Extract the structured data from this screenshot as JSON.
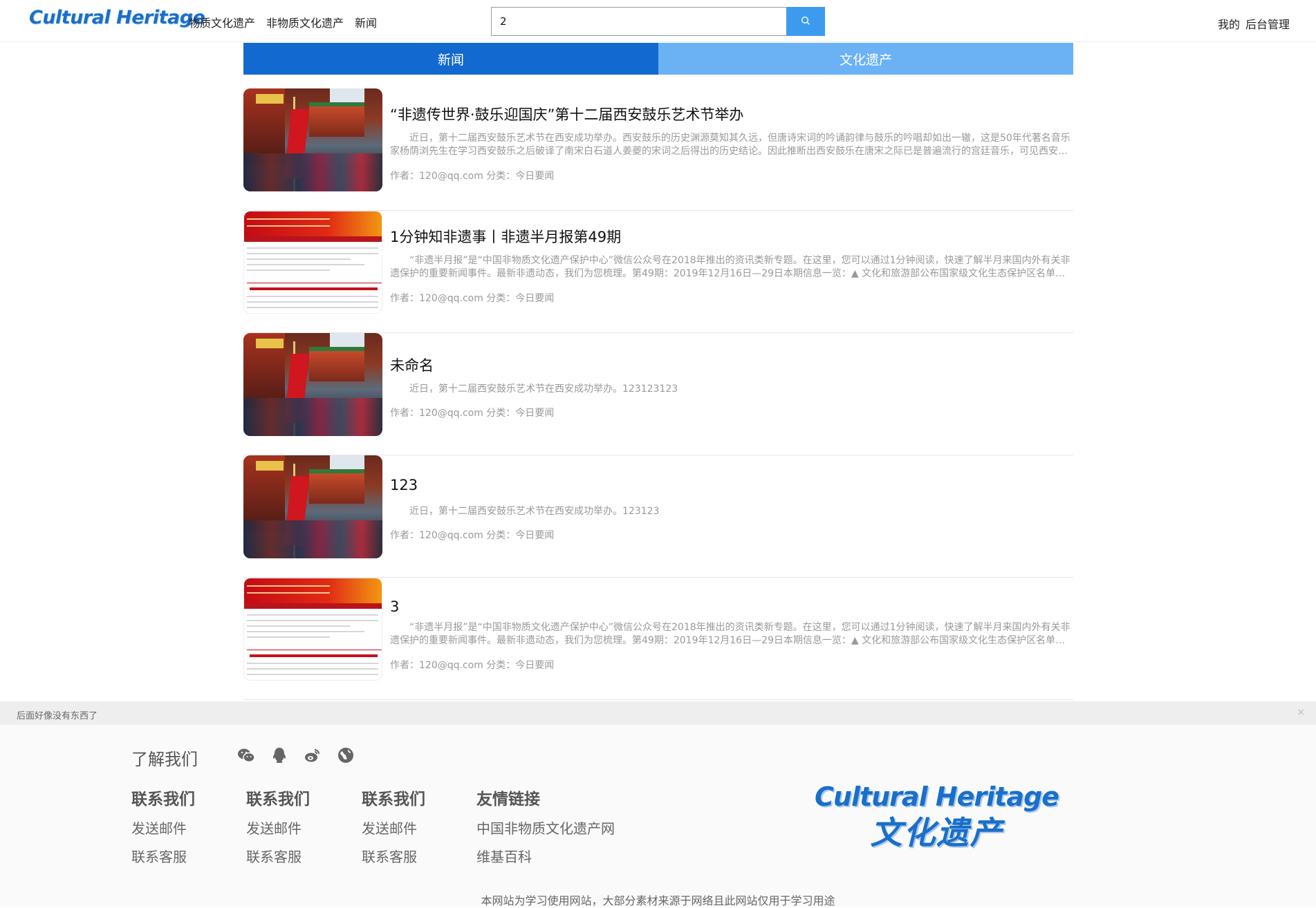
{
  "header": {
    "logo": "Cultural Heritage",
    "nav": [
      "物质文化遗产",
      "非物质文化遗产",
      "新闻"
    ],
    "search_value": "2",
    "user_links": [
      "我的",
      "后台管理"
    ]
  },
  "tabs": [
    {
      "label": "新闻",
      "active": true
    },
    {
      "label": "文化遗产",
      "active": false
    }
  ],
  "news": [
    {
      "title": "“非遗传世界·鼓乐迎国庆”第十二届西安鼓乐艺术节举办",
      "summary": "近日，第十二届西安鼓乐艺术节在西安成功举办。西安鼓乐的历史渊源莫知其久远，但唐诗宋词的吟诵韵律与鼓乐的吟唱却如出一辙，这是50年代著名音乐家杨荫浏先生在学习西安鼓乐之后破译了南宋白石道人姜夔的宋词之后得出的历史结论。因此推断出西安鼓乐在唐宋之际已是普遍流行的宫廷音乐，可见西安鼓乐历史之悠久。",
      "meta": "作者：120@qq.com 分类：今日要闻",
      "thumb": "street"
    },
    {
      "title": "1分钟知非遗事丨非遗半月报第49期",
      "summary": "“非遗半月报”是“中国非物质文化遗产保护中心”微信公众号在2018年推出的资讯类新专题。在这里，您可以通过1分钟阅读，快速了解半月来国内外有关非遗保护的重要新闻事件。最新非遗动态，我们为您梳理。第49期：2019年12月16日—29日本期信息一览：▲ 文化和旅游部公布国家级文化生态保护区名单▲ 第二届非遗影像展",
      "meta": "作者：120@qq.com 分类：今日要闻",
      "thumb": "doc"
    },
    {
      "title": "未命名",
      "summary": "近日，第十二届西安鼓乐艺术节在西安成功举办。123123123",
      "meta": "作者：120@qq.com 分类：今日要闻",
      "thumb": "street"
    },
    {
      "title": "123",
      "summary": "近日，第十二届西安鼓乐艺术节在西安成功举办。123123",
      "meta": "作者：120@qq.com 分类：今日要闻",
      "thumb": "street"
    },
    {
      "title": "3",
      "summary": "“非遗半月报”是“中国非物质文化遗产保护中心”微信公众号在2018年推出的资讯类新专题。在这里，您可以通过1分钟阅读，快速了解半月来国内外有关非遗保护的重要新闻事件。最新非遗动态，我们为您梳理。第49期：2019年12月16日—29日本期信息一览：▲ 文化和旅游部公布国家级文化生态保护区名单▲ 第二届非遗影像展",
      "meta": "作者：120@qq.com 分类：今日要闻",
      "thumb": "doc"
    }
  ],
  "notice": {
    "text": "后面好像没有东西了",
    "close": "×"
  },
  "footer": {
    "about": "了解我们",
    "social_icons": [
      "wechat-icon",
      "qq-icon",
      "weibo-icon",
      "globe-icon"
    ],
    "columns": [
      {
        "head": "联系我们",
        "links": [
          "发送邮件",
          "联系客服"
        ]
      },
      {
        "head": "联系我们",
        "links": [
          "发送邮件",
          "联系客服"
        ]
      },
      {
        "head": "联系我们",
        "links": [
          "发送邮件",
          "联系客服"
        ]
      },
      {
        "head": "友情链接",
        "links": [
          "中国非物质文化遗产网",
          "维基百科"
        ]
      }
    ],
    "logo_en": "Cultural Heritage",
    "logo_cn": "文化遗产",
    "copyright": "本网站为学习使用网站，大部分素材来源于网络且此网站仅用于学习用途"
  },
  "colors": {
    "primary": "#1269cf",
    "tab_inactive": "#6bb2f5",
    "search_button": "#3d9bef"
  }
}
